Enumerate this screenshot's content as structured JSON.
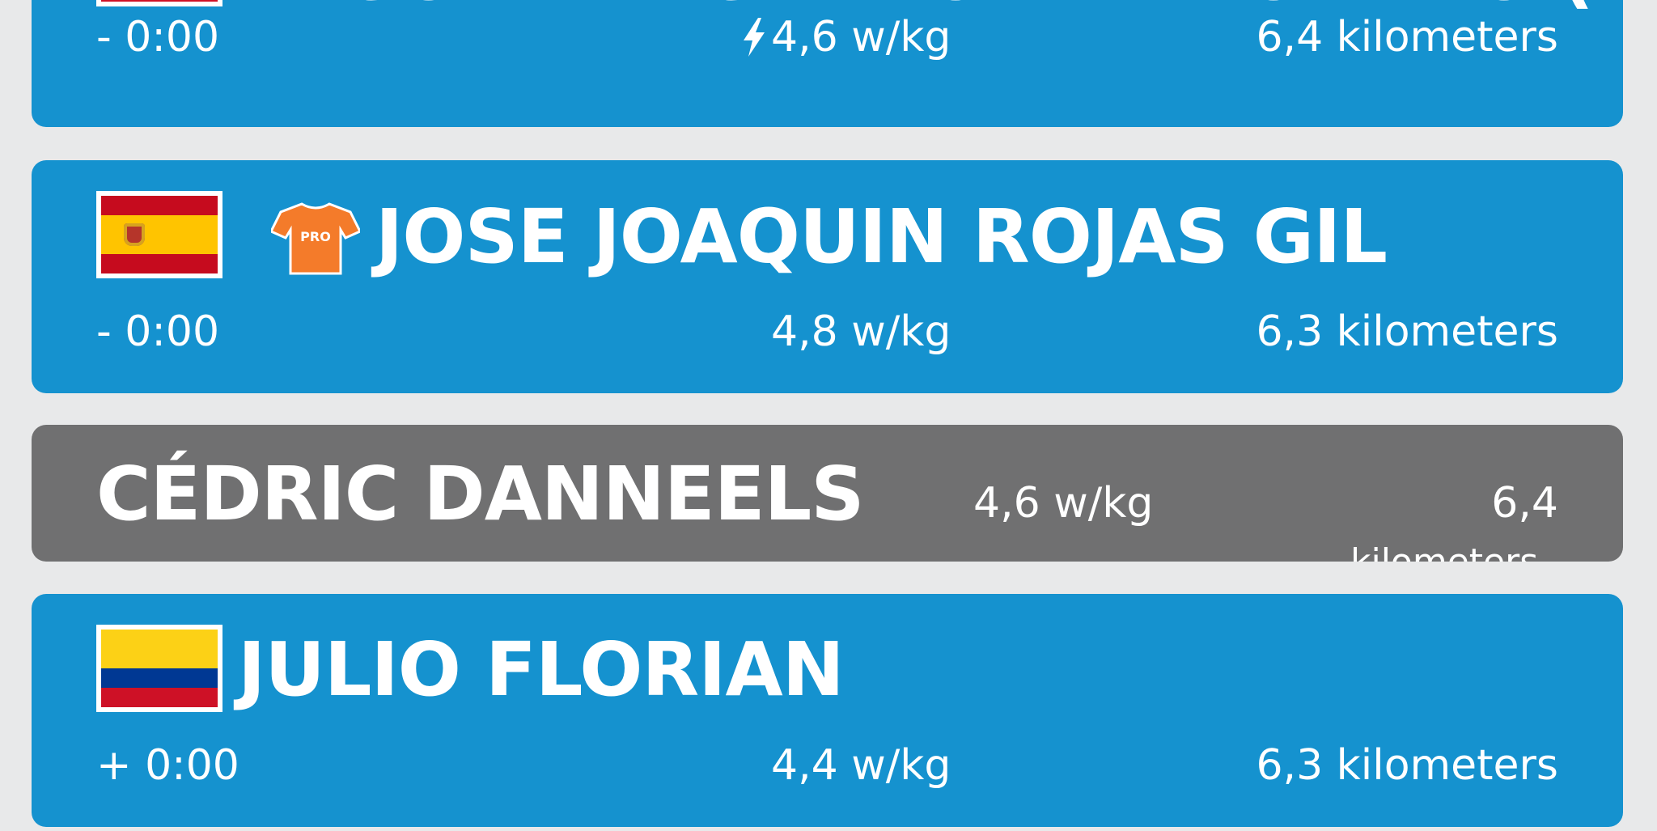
{
  "riders": [
    {
      "name": "MIGUEL ANGEL LOPEZ MORENO (ADE",
      "gap": "- 0:00",
      "power": "4,6 w/kg",
      "distance": "6,4 kilometers",
      "flag": "colombia",
      "power_icon": "lightning-icon"
    },
    {
      "name": "JOSE JOAQUIN ROJAS GIL",
      "gap": "- 0:00",
      "power": "4,8 w/kg",
      "distance": "6,3 kilometers",
      "flag": "spain",
      "jersey_icon": "pro-jersey-icon",
      "jersey_label": "PRO"
    },
    {
      "name": "CÉDRIC DANNEELS",
      "power": "4,6 w/kg",
      "distance": "6,4",
      "distance_overflow": "kilometers",
      "highlighted": true
    },
    {
      "name": "JULIO FLORIAN",
      "gap": "+ 0:00",
      "power": "4,4 w/kg",
      "distance": "6,3 kilometers",
      "flag": "colombia"
    }
  ],
  "colors": {
    "card_blue": "#1592cf",
    "card_self_gray": "#707071",
    "background": "#e8e9ea",
    "jersey_orange": "#f47b2a"
  }
}
